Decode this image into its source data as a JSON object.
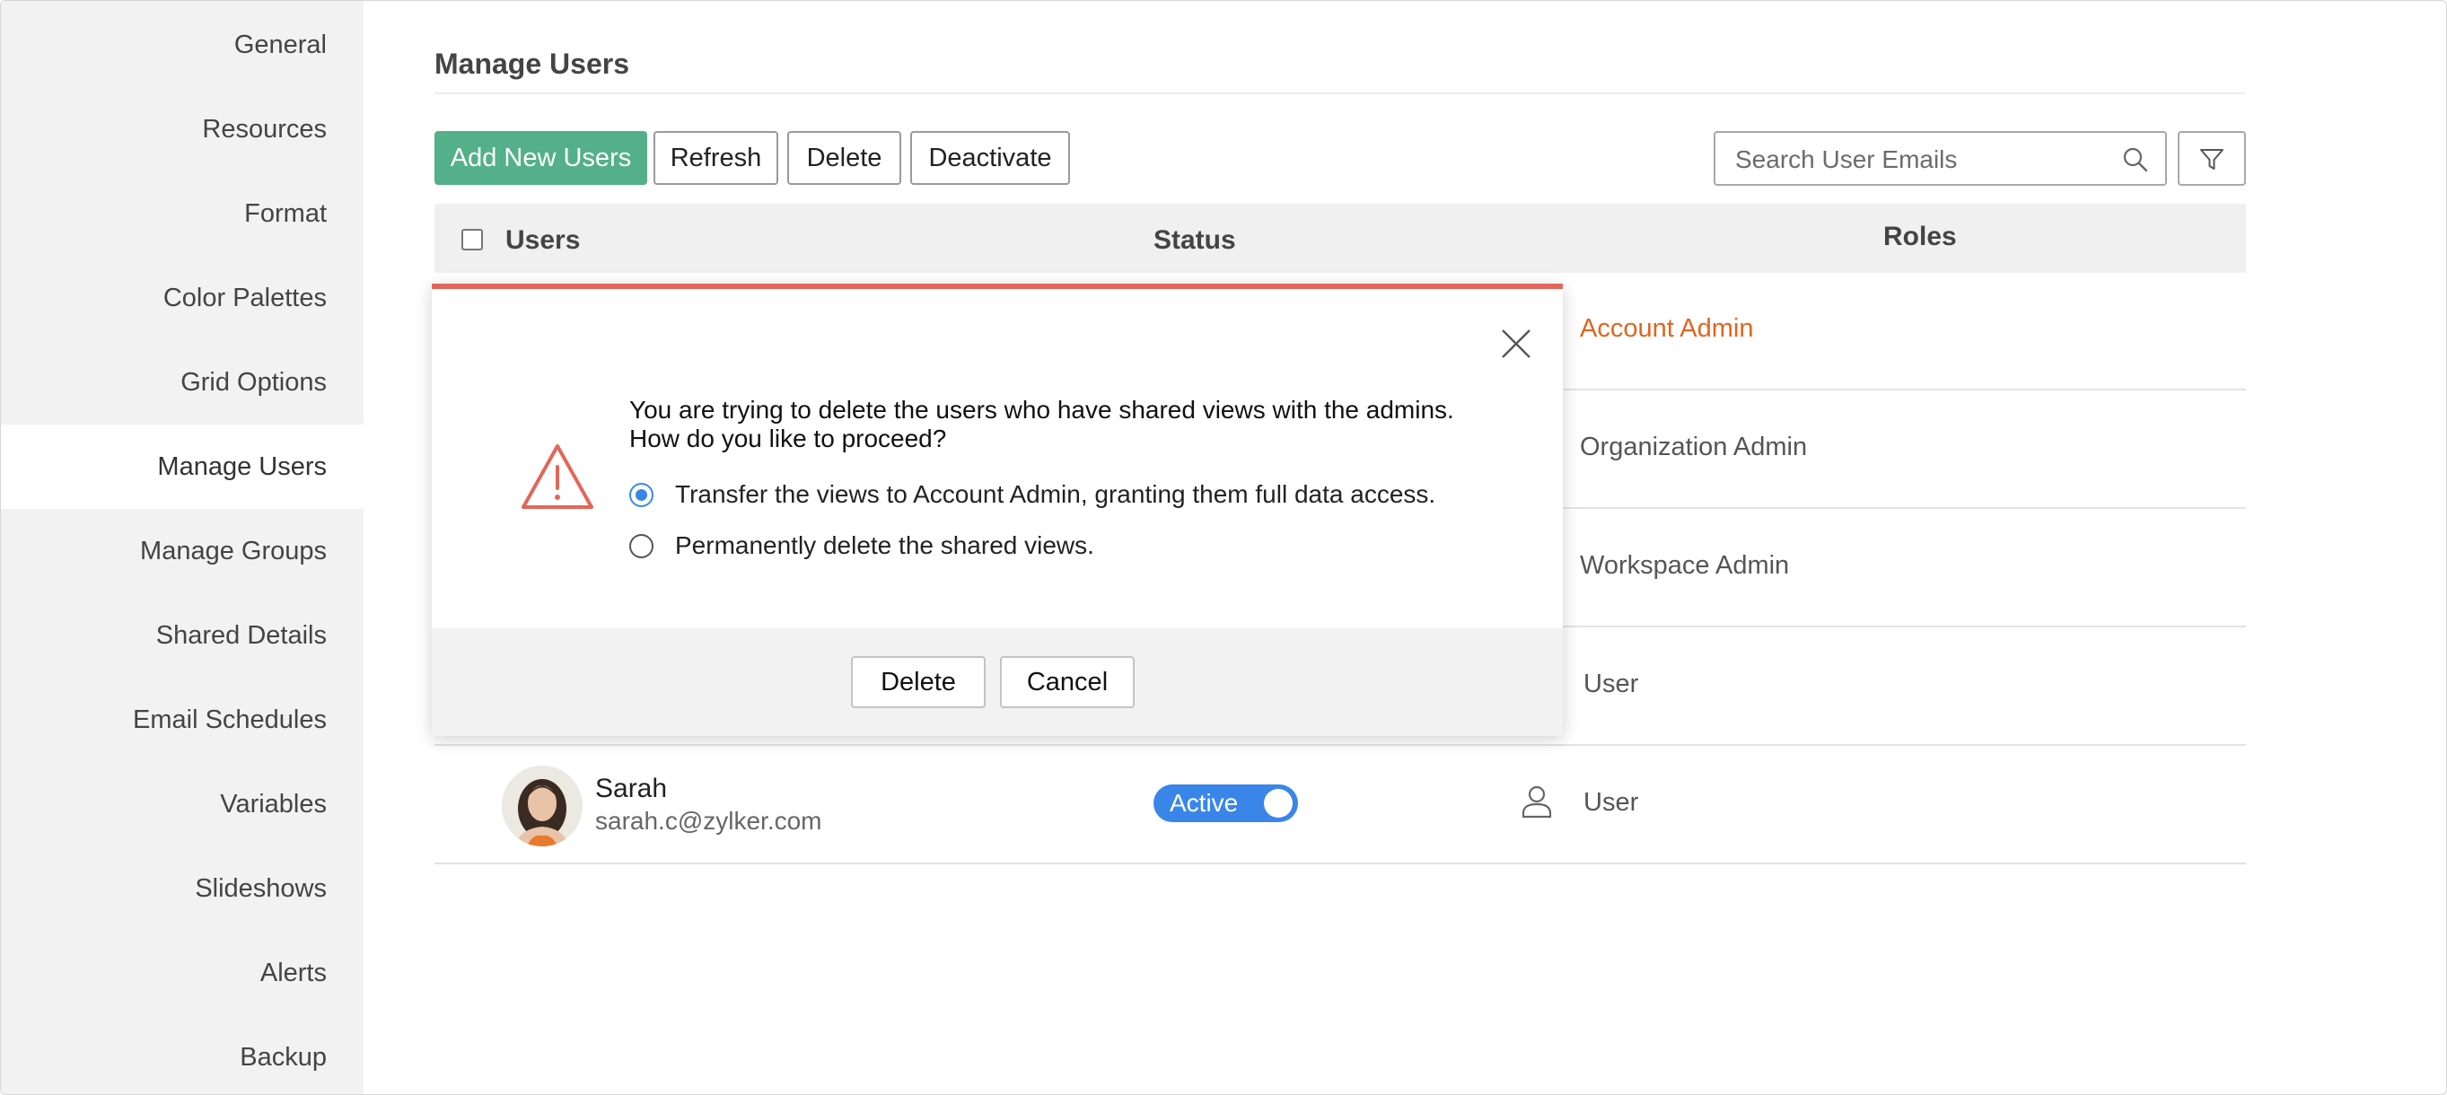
{
  "sidebar": {
    "items": [
      {
        "label": "General"
      },
      {
        "label": "Resources"
      },
      {
        "label": "Format"
      },
      {
        "label": "Color Palettes"
      },
      {
        "label": "Grid Options"
      },
      {
        "label": "Manage Users",
        "active": true
      },
      {
        "label": "Manage Groups"
      },
      {
        "label": "Shared Details"
      },
      {
        "label": "Email Schedules"
      },
      {
        "label": "Variables"
      },
      {
        "label": "Slideshows"
      },
      {
        "label": "Alerts"
      },
      {
        "label": "Backup"
      }
    ]
  },
  "main": {
    "title": "Manage Users",
    "toolbar": {
      "add_label": "Add New Users",
      "refresh_label": "Refresh",
      "delete_label": "Delete",
      "deactivate_label": "Deactivate"
    },
    "search": {
      "placeholder": "Search User Emails",
      "value": ""
    },
    "table": {
      "columns": [
        "Users",
        "Status",
        "Roles"
      ],
      "rows": [
        {
          "role": "Account Admin"
        },
        {
          "role": "Organization Admin"
        },
        {
          "role": "Workspace Admin"
        },
        {
          "role": "User"
        },
        {
          "name": "Sarah",
          "email": "sarah.c@zylker.com",
          "status": "Active",
          "role": "User"
        }
      ]
    }
  },
  "dialog": {
    "message_line1": "You are trying to delete the users who have shared views with the admins.",
    "message_line2": "How do you like to proceed?",
    "options": [
      {
        "label": "Transfer the views to Account Admin, granting them full data access.",
        "selected": true
      },
      {
        "label": "Permanently delete the shared views.",
        "selected": false
      }
    ],
    "delete_label": "Delete",
    "cancel_label": "Cancel"
  },
  "colors": {
    "primary": "#54b08a",
    "accent_blue": "#3a86e8",
    "warning": "#e2665a",
    "highlight_role": "#e0651f"
  },
  "icons": [
    "search-icon",
    "filter-icon",
    "close-icon",
    "warning-icon",
    "user-icon"
  ]
}
